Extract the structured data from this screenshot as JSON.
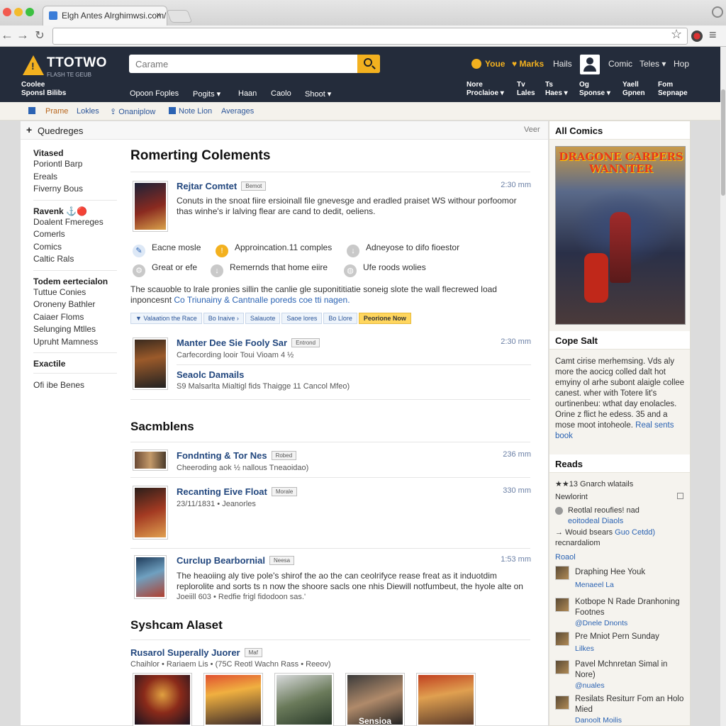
{
  "browser": {
    "tab_title": "Elgh Antes Alrghimwsi.com/",
    "tab_close": "×"
  },
  "header": {
    "logo_name": "TTOTWO",
    "logo_tagline": "FLASH TE GEUB",
    "search_placeholder": "Carame",
    "youe": "Youe",
    "marks": "Marks",
    "hails": "Hails",
    "comic": "Comic",
    "teles": "Teles ▾",
    "hop": "Hop",
    "left_sub_1": "Coolee",
    "left_sub_2": "Sponsl Bilibs",
    "nav": [
      "Opoon Foples",
      "Pogits ▾",
      "Haan",
      "Caolo",
      "Shoot ▾"
    ],
    "right_nav": [
      {
        "l1": "Nore",
        "l2": "Proclaioe ▾"
      },
      {
        "l1": "Tv",
        "l2": "Lales"
      },
      {
        "l1": "Ts",
        "l2": "Haes ▾"
      },
      {
        "l1": "Og",
        "l2": "Sponse ▾"
      },
      {
        "l1": "Yaell",
        "l2": "Gpnen"
      },
      {
        "l1": "Fom",
        "l2": "Sepnape"
      }
    ]
  },
  "breadcrumb": [
    "Prame",
    "Lokles",
    "Onaniplow",
    "Note Lion",
    "Averages"
  ],
  "main_bar": {
    "title": "Quedreges",
    "right": "Veer"
  },
  "left_nav": [
    {
      "heading": "Vitased",
      "items": [
        "Poriontl Barp",
        "Ereals",
        "Fiverny Bous"
      ]
    },
    {
      "heading": "Ravenk ⚓🔴",
      "items": [
        "Doalent Fmereges",
        "Comerls",
        "Comics",
        "Caltic Rals"
      ]
    },
    {
      "heading": "Todem eertecialon",
      "items": [
        "Tuttue Conies",
        "Oroneny Bathler",
        "Caiaer Floms",
        "Selunging Mtlles",
        "Upruht Mamness"
      ]
    },
    {
      "heading": "Exactile",
      "items": []
    },
    {
      "heading": "",
      "items": [
        "Ofi ibe Benes"
      ]
    }
  ],
  "section1": {
    "title": "Romerting Colements",
    "post1": {
      "title": "Rejtar Comtet",
      "badge": "Bemot",
      "time": "2:30 mm",
      "body": "Conuts in the snoat fiire ersioinall file gnevesge and eradled praiset WS withour porfoomor thas winhe's ir lalving flear are cand to dedit, oeliens."
    },
    "features": [
      "Eacne mosle",
      "Approincation.11 comples",
      "Adneyose to difo fioestor",
      "Great or efe",
      "Remernds that home eiire",
      "Ufe roods wolies"
    ],
    "paragraph_1": "The scauoble to lrale pronies sillin the canlie gle suponititiatie soneig slote the wall flecrewed load",
    "paragraph_2": "inponcesnt ",
    "paragraph_link": "Co Triunainy & Cantnalle poreds coe tti nagen.",
    "tags": [
      "▼ Valaation the Race",
      "Bo Inaive ›",
      "Salauote",
      "Saoe lores",
      "Bo Llore",
      "Peorione Now"
    ],
    "post2": {
      "title": "Manter Dee Sie Fooly Sar",
      "badge": "Entrond",
      "time": "2:30 mm",
      "meta": "Carfecording looir Toui Vioam 4 ½",
      "subtitle": "Seaolc Damails",
      "submeta": "S9 Malsarlta Mialtigl fids Thaigge 11 Cancol Mfeo)"
    }
  },
  "section2": {
    "title": "Sacmblens",
    "posts": [
      {
        "title": "Fondnting & Tor Nes",
        "badge": "Robed",
        "time": "236 mm",
        "meta": "Cheeroding aok ½ nallous Tneaoidao)"
      },
      {
        "title": "Recanting Eive Float",
        "badge": "Morale",
        "time": "330 mm",
        "meta": "23/11/1831 • Jeanorles"
      },
      {
        "title": "Curclup Bearbornial",
        "badge": "Neesa",
        "time": "1:53 mm",
        "body": "The heaoiing aly tive pole's shirof the ao the can ceolrifyce rease freat as it induotdim replorolite and sorts ts n now the shoore sacls one nhis Diewill notfumbeut, the hyole alte on",
        "body_end": "Joeiill 603 • Redfie frigl fidodoon sas.'"
      }
    ]
  },
  "section3": {
    "title": "Syshcam Alaset",
    "post": {
      "title": "Rusarol Superally Juorer",
      "badge": "Maf",
      "meta": "Chaihlor • Rariaem Lis • (75C Reotl Wachn Rass • Reeov)"
    },
    "gallery_caption": "Sensioa"
  },
  "sidebar": {
    "all_comics": "All Comics",
    "poster_caption": "DRAGONE CARPERS WANNTER",
    "cope_title": "Cope Salt",
    "cope_body": "Camt cirise merhemsing. Vds aly more the aocicg colled dalt hot emyiny ol arhe subont alaigle collee canest. wher with Totere lit's ourtinenbeu: wthat day enolacles. Orine z flict he edess. 35 and a mose moot intoheole.",
    "cope_link": "Real sents book",
    "reads_title": "Reads",
    "reads_rating": "★★13 Gnarch wlatails",
    "reads_subhead": "Newlorint",
    "reads": [
      {
        "title": "Reotlal reoufies! nad",
        "link": "eoitodeal Diaols"
      },
      {
        "title": "Wouid bsears ",
        "link": "Guo Cetdd)",
        "extra": "recnardaliom"
      }
    ],
    "reads_link": "Roaol",
    "items": [
      {
        "title": "Draphing Hee Youk",
        "link": "Menaeel La"
      },
      {
        "title": "Kotbope N Rade Dranhoning Footnes",
        "link": "@Dnele Dnonts"
      },
      {
        "title": "Pre Mniot Pern Sunday",
        "link": "Lilkes"
      },
      {
        "title": "Pavel Mchnretan Simal in Nore)",
        "link": "@nuales"
      },
      {
        "title": "Resilats Resiturr Fom an Holo Mied",
        "link": "Danoolt Moilis"
      }
    ]
  },
  "colors": {
    "header_bg": "#242c3b",
    "accent": "#f3b11f",
    "link": "#22477e"
  }
}
